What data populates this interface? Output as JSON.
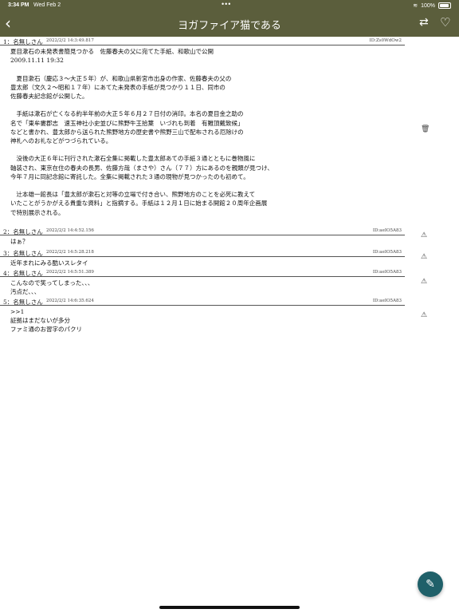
{
  "status": {
    "time": "3:34 PM",
    "date": "Wed Feb 2",
    "battery": "100%"
  },
  "nav": {
    "title": "ヨガファイア猫である"
  },
  "posts": [
    {
      "header": "1：名無しさん",
      "timestamp": "2022/2/2 14:3:49.817",
      "id": "ID:Zs0WdOw2",
      "body": "夏目漱石の未発表書簡見つかる　佐藤春夫の父に宛てた手紙、和歌山で公開\n2009.11.11 19:32\n\n　夏目漱石（慶応３～大正５年）が、和歌山県新宮市出身の作家、佐藤春夫の父の\n豊太郎（文久２～昭和１７年）にあてた未発表の手紙が見つかり１１日、同市の\n佐藤春夫記念館が公開した。\n\n　手紙は漱石が亡くなる約半年前の大正５年６月２７日付の消印。本名の夏目金之助の\n名で「東牟婁郡志　速玉神社小史並びに熊野牛王拾葉　いづれも到着　有難頂戴致候」\nなどと書かれ、豊太郎から送られた熊野地方の歴史書や熊野三山で配布される厄除けの\n神札へのお礼などがつづられている。\n\n　没後の大正６年に刊行された漱石全集に掲載した豊太郎あての手紙３通とともに巻物風に\n軸装され、東京在住の春夫の長男、佐藤方哉（まさや）さん（７７）方にあるのを親類が見つけ、\n今年７月に同記念館に寄託した。全集に掲載された３通の現物が見つかったのも初めて。\n\n　辻本雄一館長は「豊太郎が漱石と対等の立場で付き合い、熊野地方のことを必死に教えて\nいたことがうかがえる貴重な資料」と指摘する。手紙は１２月１日に始まる開館２０周年企画展\nで特別展示される。"
    },
    {
      "header": "2：名無しさん",
      "timestamp": "2022/2/2 14:4:52.156",
      "id": "ID:aeIO5A83",
      "body": "はぁ？"
    },
    {
      "header": "3：名無しさん",
      "timestamp": "2022/2/2 14:5:28.218",
      "id": "ID:aeIO5A83",
      "body": "近年まれにみる酷いスレタイ"
    },
    {
      "header": "4：名無しさん",
      "timestamp": "2022/2/2 14:5:51.389",
      "id": "ID:aeIO5A83",
      "body": "こんなので笑ってしまった、、、\n汚点だ、、、"
    },
    {
      "header": "5：名無しさん",
      "timestamp": "2022/2/2 14:6:35.624",
      "id": "ID:aeIO5A83",
      "body": ">>1\n証拠はまだないが多分\nファミ通のお習字のパクリ"
    }
  ],
  "icons": {
    "back": "chevron-left-icon",
    "sync": "sync-icon",
    "heart": "heart-icon",
    "trash": "trash-icon",
    "warning": "warning-icon",
    "compose": "pencil-icon"
  },
  "colors": {
    "navbar": "#5b5e3c",
    "fab": "#1f6069"
  }
}
